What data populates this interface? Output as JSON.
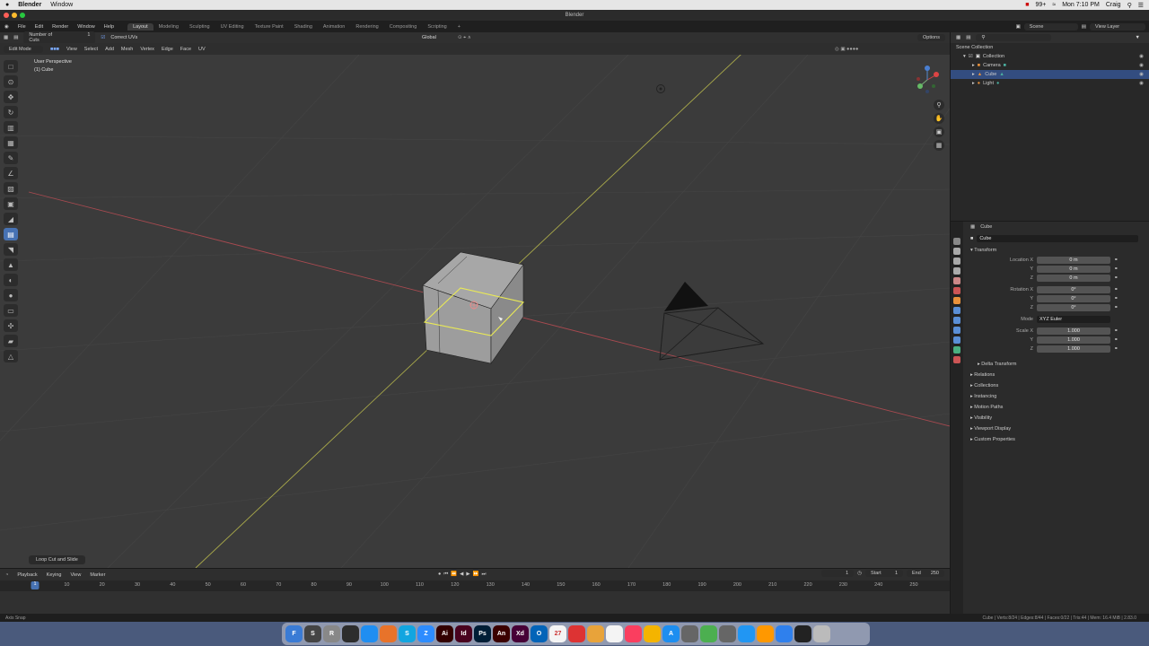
{
  "mac_menubar": {
    "app": "Blender",
    "menu": "Window",
    "battery": "99+",
    "clock": "Mon 7:10 PM",
    "user": "Craig"
  },
  "window": {
    "title": "Blender"
  },
  "topbar": {
    "menus": [
      "File",
      "Edit",
      "Render",
      "Window",
      "Help"
    ],
    "workspaces": [
      "Layout",
      "Modeling",
      "Sculpting",
      "UV Editing",
      "Texture Paint",
      "Shading",
      "Animation",
      "Rendering",
      "Compositing",
      "Scripting"
    ],
    "active_workspace": "Layout",
    "scene": "Scene",
    "view_layer": "View Layer"
  },
  "tool_header": {
    "cuts_label": "Number of Cuts",
    "cuts_value": "1",
    "correct_uvs": "Correct UVs",
    "transform_orientation": "Global",
    "options": "Options"
  },
  "viewport_header": {
    "mode": "Edit Mode",
    "menus": [
      "View",
      "Select",
      "Add",
      "Mesh",
      "Vertex",
      "Edge",
      "Face",
      "UV"
    ]
  },
  "viewport": {
    "view_name": "User Perspective",
    "object_label": "(1) Cube",
    "last_operator": "Loop Cut and Slide"
  },
  "outliner": {
    "root": "Scene Collection",
    "items": [
      {
        "name": "Collection"
      },
      {
        "name": "Camera"
      },
      {
        "name": "Cube"
      },
      {
        "name": "Light"
      }
    ]
  },
  "properties": {
    "object_name": "Cube",
    "sections": {
      "transform": "Transform",
      "delta": "Delta Transform",
      "others": [
        "Relations",
        "Collections",
        "Instancing",
        "Motion Paths",
        "Visibility",
        "Viewport Display",
        "Custom Properties"
      ]
    },
    "location": {
      "label": "Location X",
      "x": "0 m",
      "y": "0 m",
      "z": "0 m"
    },
    "rotation": {
      "label": "Rotation X",
      "x": "0°",
      "y": "0°",
      "z": "0°"
    },
    "mode": {
      "label": "Mode",
      "value": "XYZ Euler"
    },
    "scale": {
      "label": "Scale X",
      "x": "1.000",
      "y": "1.000",
      "z": "1.000"
    },
    "axis_y": "Y",
    "axis_z": "Z"
  },
  "timeline": {
    "menus": [
      "Playback",
      "Keying",
      "View",
      "Marker"
    ],
    "current_frame": "1",
    "start_label": "Start",
    "start": "1",
    "end_label": "End",
    "end": "250",
    "ruler": [
      "1",
      "10",
      "20",
      "30",
      "40",
      "50",
      "60",
      "70",
      "80",
      "90",
      "100",
      "110",
      "120",
      "130",
      "140",
      "150",
      "160",
      "170",
      "180",
      "190",
      "200",
      "210",
      "220",
      "230",
      "240",
      "250"
    ]
  },
  "status_bar": {
    "left": "Axis Snap",
    "right": "Cube | Verts:8/24 | Edges:8/44 | Faces:0/22 | Tris:44 | Mem: 16.4 MiB | 2.83.0"
  },
  "dock": {
    "apps": [
      {
        "label": "F",
        "color": "#3a7bd5"
      },
      {
        "label": "S",
        "color": "#444"
      },
      {
        "label": "R",
        "color": "#888"
      },
      {
        "label": "",
        "color": "#2d2d2d"
      },
      {
        "label": "",
        "color": "#1f8ef1"
      },
      {
        "label": "",
        "color": "#e8732a"
      },
      {
        "label": "S",
        "color": "#12a5e0"
      },
      {
        "label": "Z",
        "color": "#2d8cff"
      },
      {
        "label": "Ai",
        "color": "#330000"
      },
      {
        "label": "Id",
        "color": "#49021f"
      },
      {
        "label": "Ps",
        "color": "#001e36"
      },
      {
        "label": "An",
        "color": "#3b0000"
      },
      {
        "label": "Xd",
        "color": "#470137"
      },
      {
        "label": "O",
        "color": "#0364b8"
      },
      {
        "label": "27",
        "color": "#f4f4f4"
      },
      {
        "label": "",
        "color": "#d33"
      },
      {
        "label": "",
        "color": "#e8a33a"
      },
      {
        "label": "",
        "color": "#f4f4f4"
      },
      {
        "label": "",
        "color": "#fa3e5f"
      },
      {
        "label": "",
        "color": "#f4b400"
      },
      {
        "label": "A",
        "color": "#1d8ef0"
      },
      {
        "label": "",
        "color": "#666"
      },
      {
        "label": "",
        "color": "#4caf50"
      },
      {
        "label": "",
        "color": "#666"
      },
      {
        "label": "",
        "color": "#2196f3"
      },
      {
        "label": "",
        "color": "#ff9800"
      },
      {
        "label": "",
        "color": "#2f80ed"
      },
      {
        "label": "",
        "color": "#222"
      },
      {
        "label": "",
        "color": "#bbb"
      }
    ]
  }
}
